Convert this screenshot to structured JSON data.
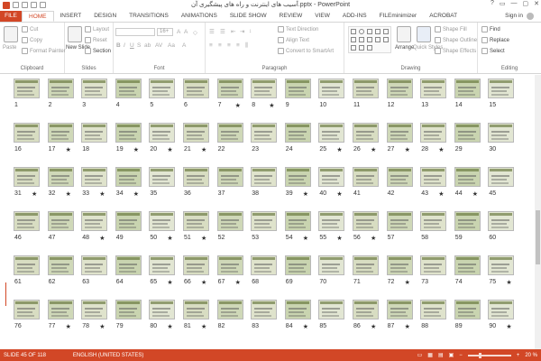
{
  "window": {
    "title": "آسیب های اینترنت و راه های پیشگیری آن.pptx - PowerPoint",
    "controls": [
      "?",
      "▭",
      "—",
      "▢",
      "✕"
    ]
  },
  "tabs": [
    {
      "label": "FILE"
    },
    {
      "label": "HOME"
    },
    {
      "label": "INSERT"
    },
    {
      "label": "DESIGN"
    },
    {
      "label": "TRANSITIONS"
    },
    {
      "label": "ANIMATIONS"
    },
    {
      "label": "SLIDE SHOW"
    },
    {
      "label": "REVIEW"
    },
    {
      "label": "VIEW"
    },
    {
      "label": "ADD-INS"
    },
    {
      "label": "FILEminimizer"
    },
    {
      "label": "ACROBAT"
    }
  ],
  "signin": "Sign in",
  "ribbon": {
    "clipboard": {
      "paste": "Paste",
      "cut": "Cut",
      "copy": "Copy",
      "format_painter": "Format Painter",
      "label": "Clipboard"
    },
    "slides": {
      "new_slide": "New Slide",
      "layout": "Layout",
      "reset": "Reset",
      "section": "Section",
      "label": "Slides"
    },
    "font": {
      "size": "16+",
      "label": "Font"
    },
    "paragraph": {
      "text_direction": "Text Direction",
      "align_text": "Align Text",
      "smartart": "Convert to SmartArt",
      "label": "Paragraph"
    },
    "drawing": {
      "arrange": "Arrange",
      "quick_styles": "Quick Styles",
      "shape_fill": "Shape Fill",
      "shape_outline": "Shape Outline",
      "shape_effects": "Shape Effects",
      "label": "Drawing"
    },
    "editing": {
      "find": "Find",
      "replace": "Replace",
      "select": "Select",
      "label": "Editing"
    }
  },
  "slides": [
    {
      "n": "1",
      "star": ""
    },
    {
      "n": "2",
      "star": ""
    },
    {
      "n": "3",
      "star": ""
    },
    {
      "n": "4",
      "star": ""
    },
    {
      "n": "5",
      "star": ""
    },
    {
      "n": "6",
      "star": ""
    },
    {
      "n": "7",
      "star": "★"
    },
    {
      "n": "8",
      "star": "★"
    },
    {
      "n": "9",
      "star": ""
    },
    {
      "n": "10",
      "star": ""
    },
    {
      "n": "11",
      "star": ""
    },
    {
      "n": "12",
      "star": ""
    },
    {
      "n": "13",
      "star": ""
    },
    {
      "n": "14",
      "star": ""
    },
    {
      "n": "15",
      "star": ""
    },
    {
      "n": "16",
      "star": ""
    },
    {
      "n": "17",
      "star": "★"
    },
    {
      "n": "18",
      "star": ""
    },
    {
      "n": "19",
      "star": "★"
    },
    {
      "n": "20",
      "star": "★"
    },
    {
      "n": "21",
      "star": "★"
    },
    {
      "n": "22",
      "star": ""
    },
    {
      "n": "23",
      "star": ""
    },
    {
      "n": "24",
      "star": ""
    },
    {
      "n": "25",
      "star": "★"
    },
    {
      "n": "26",
      "star": "★"
    },
    {
      "n": "27",
      "star": "★"
    },
    {
      "n": "28",
      "star": "★"
    },
    {
      "n": "29",
      "star": ""
    },
    {
      "n": "30",
      "star": ""
    },
    {
      "n": "31",
      "star": "★"
    },
    {
      "n": "32",
      "star": "★"
    },
    {
      "n": "33",
      "star": "★"
    },
    {
      "n": "34",
      "star": "★"
    },
    {
      "n": "35",
      "star": ""
    },
    {
      "n": "36",
      "star": ""
    },
    {
      "n": "37",
      "star": ""
    },
    {
      "n": "38",
      "star": ""
    },
    {
      "n": "39",
      "star": "★"
    },
    {
      "n": "40",
      "star": "★"
    },
    {
      "n": "41",
      "star": ""
    },
    {
      "n": "42",
      "star": ""
    },
    {
      "n": "43",
      "star": "★"
    },
    {
      "n": "44",
      "star": "★"
    },
    {
      "n": "45",
      "star": ""
    },
    {
      "n": "46",
      "star": ""
    },
    {
      "n": "47",
      "star": ""
    },
    {
      "n": "48",
      "star": "★"
    },
    {
      "n": "49",
      "star": ""
    },
    {
      "n": "50",
      "star": "★"
    },
    {
      "n": "51",
      "star": "★"
    },
    {
      "n": "52",
      "star": ""
    },
    {
      "n": "53",
      "star": ""
    },
    {
      "n": "54",
      "star": "★"
    },
    {
      "n": "55",
      "star": "★"
    },
    {
      "n": "56",
      "star": "★"
    },
    {
      "n": "57",
      "star": ""
    },
    {
      "n": "58",
      "star": ""
    },
    {
      "n": "59",
      "star": ""
    },
    {
      "n": "60",
      "star": ""
    },
    {
      "n": "61",
      "star": ""
    },
    {
      "n": "62",
      "star": ""
    },
    {
      "n": "63",
      "star": ""
    },
    {
      "n": "64",
      "star": ""
    },
    {
      "n": "65",
      "star": "★"
    },
    {
      "n": "66",
      "star": "★"
    },
    {
      "n": "67",
      "star": "★"
    },
    {
      "n": "68",
      "star": ""
    },
    {
      "n": "69",
      "star": ""
    },
    {
      "n": "70",
      "star": ""
    },
    {
      "n": "71",
      "star": ""
    },
    {
      "n": "72",
      "star": "★"
    },
    {
      "n": "73",
      "star": ""
    },
    {
      "n": "74",
      "star": ""
    },
    {
      "n": "75",
      "star": "★"
    },
    {
      "n": "76",
      "star": ""
    },
    {
      "n": "77",
      "star": "★"
    },
    {
      "n": "78",
      "star": "★"
    },
    {
      "n": "79",
      "star": ""
    },
    {
      "n": "80",
      "star": "★"
    },
    {
      "n": "81",
      "star": "★"
    },
    {
      "n": "82",
      "star": ""
    },
    {
      "n": "83",
      "star": ""
    },
    {
      "n": "84",
      "star": "★"
    },
    {
      "n": "85",
      "star": ""
    },
    {
      "n": "86",
      "star": "★"
    },
    {
      "n": "87",
      "star": "★"
    },
    {
      "n": "88",
      "star": ""
    },
    {
      "n": "89",
      "star": ""
    },
    {
      "n": "90",
      "star": "★"
    }
  ],
  "statusbar": {
    "slide_info": "SLIDE 45 OF 118",
    "language": "ENGLISH (UNITED STATES)",
    "zoom": "20 %"
  },
  "colors": {
    "accent": "#d24726",
    "thumb_bg": "#d6dcc0",
    "selected": "#d24726"
  }
}
